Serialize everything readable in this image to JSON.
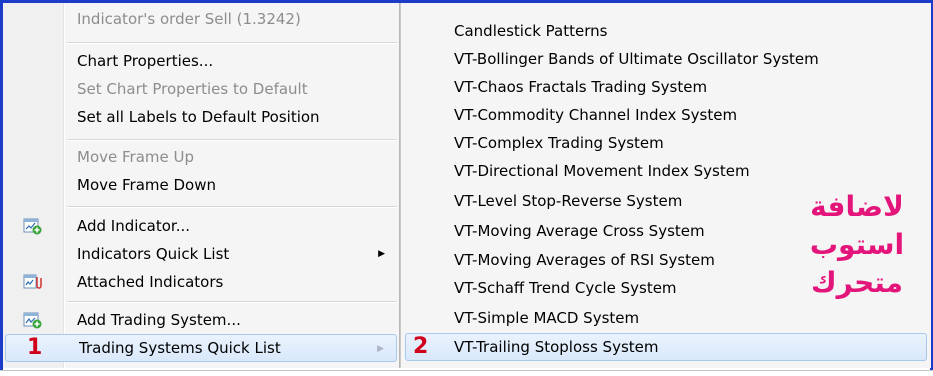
{
  "left_menu": {
    "items": [
      {
        "label": "Indicator's order Sell (1.3242)",
        "disabled": true
      },
      {
        "label": "Chart Properties...",
        "disabled": false
      },
      {
        "label": "Set Chart Properties to Default",
        "disabled": true
      },
      {
        "label": "Set all Labels to Default Position",
        "disabled": false
      },
      {
        "label": "Move Frame Up",
        "disabled": true
      },
      {
        "label": "Move Frame Down",
        "disabled": false
      },
      {
        "label": "Add Indicator...",
        "disabled": false,
        "icon": "add-indicator-icon"
      },
      {
        "label": "Indicators Quick List",
        "disabled": false,
        "submenu": true
      },
      {
        "label": "Attached Indicators",
        "disabled": false,
        "icon": "attached-indicators-icon"
      },
      {
        "label": "Add Trading System...",
        "disabled": false,
        "icon": "add-trading-system-icon"
      },
      {
        "label": "Trading Systems Quick List",
        "disabled": false,
        "submenu": true,
        "highlighted": true
      }
    ]
  },
  "submenu": {
    "items": [
      "Candlestick Patterns",
      "VT-Bollinger Bands of Ultimate Oscillator System",
      "VT-Chaos Fractals Trading System",
      "VT-Commodity Channel Index System",
      "VT-Complex Trading System",
      "VT-Directional Movement Index System",
      "VT-Level Stop-Reverse System",
      "VT-Moving Average Cross System",
      "VT-Moving Averages of RSI System",
      "VT-Schaff Trend Cycle System",
      "VT-Simple MACD System",
      "VT-Trailing Stoploss System"
    ],
    "highlighted_item": "VT-Trailing Stoploss System"
  },
  "annotations": {
    "step1": "1",
    "step2": "2",
    "arabic_line1": "لاضافة",
    "arabic_line2": "استوب",
    "arabic_line3": "متحرك"
  },
  "colors": {
    "frame_border": "#1a3cc8",
    "annotation_red": "#d0021b",
    "annotation_pink": "#e4157a",
    "highlight_bg": "#d9e8fb"
  }
}
